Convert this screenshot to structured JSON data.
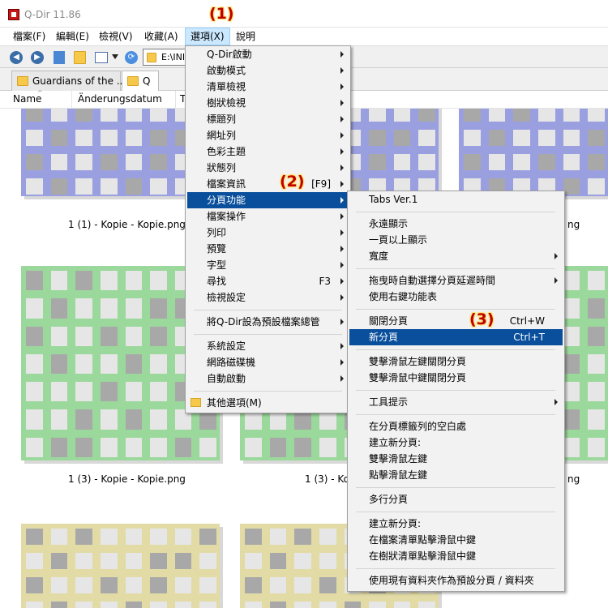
{
  "window": {
    "title": "Q-Dir 11.86"
  },
  "menubar": [
    {
      "label": "檔案(F)"
    },
    {
      "label": "編輯(E)"
    },
    {
      "label": "檢視(V)"
    },
    {
      "label": "收藏(A)"
    },
    {
      "label": "選項(X)"
    },
    {
      "label": "說明"
    }
  ],
  "toolbar": {
    "address_value": "E:\\INI"
  },
  "tabs": [
    {
      "label": "Guardians of the ..."
    },
    {
      "label": "Q"
    }
  ],
  "columns": [
    {
      "label": "Name"
    },
    {
      "label": "Änderungsdatum"
    },
    {
      "label": "T"
    }
  ],
  "thumbnails": [
    {
      "caption": "",
      "color": "#9a9fe0",
      "light": "#e6e6f5",
      "bg": "#e6e6f7"
    },
    {
      "caption": "",
      "color": "#9a9fe0",
      "light": "#e6e6f5",
      "bg": "#e6e6f7"
    },
    {
      "caption": "",
      "color": "#9a9fe0",
      "light": "#e6e6f5",
      "bg": "#e6e6f7"
    },
    {
      "caption": "1 (1) - Kopie - Kopie.png",
      "color": "#9a9fe0"
    },
    {
      "caption": "ng",
      "color": "#9a9fe0"
    },
    {
      "caption": "",
      "color": "#9bd89b",
      "bg": "#e3f3e3"
    },
    {
      "caption": "",
      "color": "#9bd89b",
      "bg": "#e3f3e3"
    },
    {
      "caption": "",
      "color": "#9bd89b",
      "bg": "#e3f3e3"
    },
    {
      "caption": "1 (3) - Kopie - Kopie.png"
    },
    {
      "caption": "1 (3) - Kop"
    },
    {
      "caption": "ng"
    },
    {
      "caption": "",
      "color": "#e2dba6",
      "bg": "#f5f2df"
    },
    {
      "caption": "",
      "color": "#e2dba6",
      "bg": "#f5f2df"
    }
  ],
  "options_menu": [
    {
      "label": "Q-Dir啟動",
      "submenu": true
    },
    {
      "label": "啟動模式",
      "submenu": true
    },
    {
      "label": "清單檢視",
      "submenu": true
    },
    {
      "label": "樹狀檢視",
      "submenu": true
    },
    {
      "label": "標題列",
      "submenu": true
    },
    {
      "label": "網址列",
      "submenu": true
    },
    {
      "label": "色彩主題",
      "submenu": true
    },
    {
      "label": "狀態列",
      "submenu": true
    },
    {
      "label": "檔案資訊",
      "shortcut": "[F9]",
      "submenu": true
    },
    {
      "label": "分頁功能",
      "submenu": true,
      "highlighted": true
    },
    {
      "label": "檔案操作",
      "submenu": true
    },
    {
      "label": "列印",
      "submenu": true
    },
    {
      "label": "預覽",
      "submenu": true
    },
    {
      "label": "字型",
      "submenu": true
    },
    {
      "label": "尋找",
      "shortcut": "F3",
      "submenu": true
    },
    {
      "label": "檢視設定",
      "submenu": true
    },
    {
      "label": "將Q-Dir設為預設檔案總管",
      "submenu": true
    },
    {
      "label": "系統設定",
      "submenu": true
    },
    {
      "label": "網路磁碟機",
      "submenu": true
    },
    {
      "label": "自動啟動",
      "submenu": true
    },
    {
      "label": "其他選項(M)"
    }
  ],
  "tabs_submenu": [
    {
      "label": "Tabs Ver.1"
    },
    {
      "label": "永遠顯示"
    },
    {
      "label": "一頁以上顯示"
    },
    {
      "label": "寬度",
      "submenu": true
    },
    {
      "label": "拖曳時自動選擇分頁延遲時間",
      "submenu": true
    },
    {
      "label": "使用右鍵功能表"
    },
    {
      "label": "關閉分頁",
      "shortcut": "Ctrl+W"
    },
    {
      "label": "新分頁",
      "shortcut": "Ctrl+T",
      "highlighted": true
    },
    {
      "label": "雙擊滑鼠左鍵關閉分頁"
    },
    {
      "label": "雙擊滑鼠中鍵關閉分頁"
    },
    {
      "label": "工具提示",
      "submenu": true
    },
    {
      "label": "在分頁標籤列的空白處"
    },
    {
      "label": "建立新分頁:"
    },
    {
      "label": "雙擊滑鼠左鍵"
    },
    {
      "label": "點擊滑鼠左鍵"
    },
    {
      "label": "多行分頁"
    },
    {
      "label": "建立新分頁:"
    },
    {
      "label": "在檔案清單點擊滑鼠中鍵"
    },
    {
      "label": "在樹狀清單點擊滑鼠中鍵"
    },
    {
      "label": "使用現有資料夾作為預設分頁 / 資料夾"
    }
  ],
  "annotations": [
    {
      "label": "(1)"
    },
    {
      "label": "(2)"
    },
    {
      "label": "(3)"
    }
  ]
}
